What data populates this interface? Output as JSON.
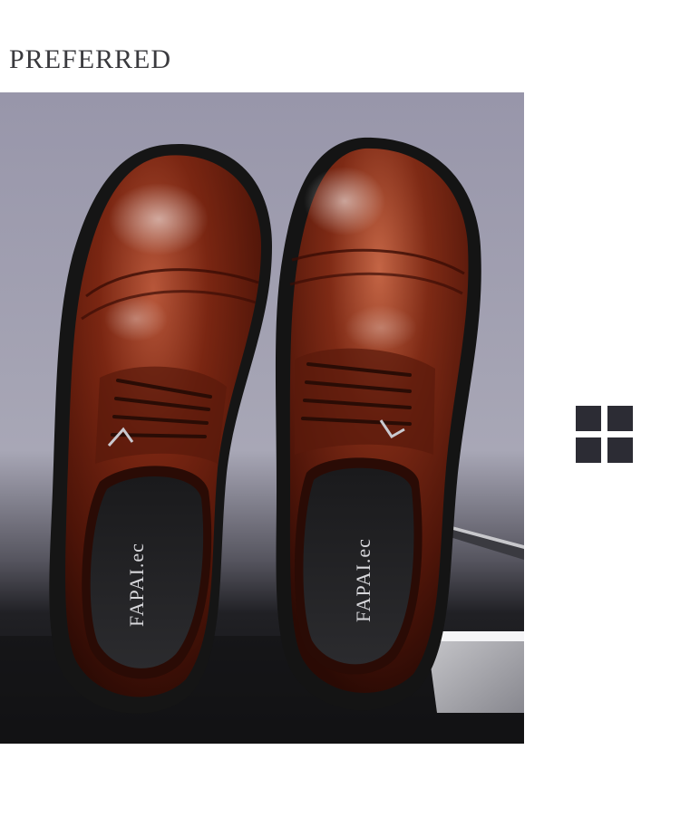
{
  "section": {
    "title": "PREFERRED"
  },
  "product_photo": {
    "insole_brand_left": "FAPAI.ec",
    "insole_brand_right": "FAPAI.ec"
  },
  "icons": {
    "grid_icon": "grid-icon"
  },
  "colors": {
    "heading_text": "#3a3a3e",
    "icon_fill": "#2c2c34",
    "leather": "#6b1f10",
    "background_top": "#a9a8b8",
    "background_bottom": "#1e1e22"
  }
}
